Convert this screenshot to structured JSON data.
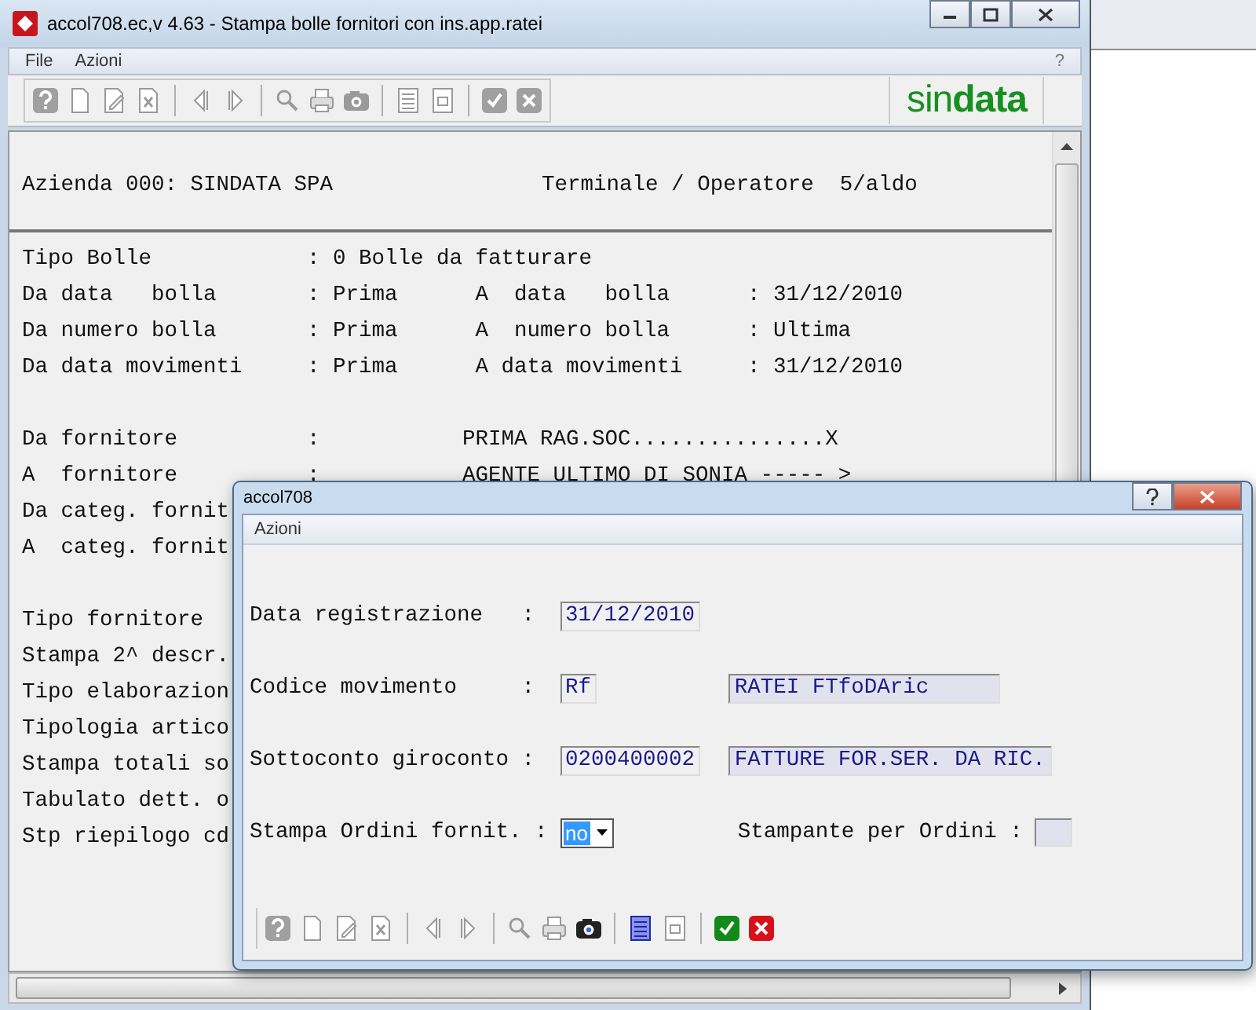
{
  "main_window": {
    "title": "accol708.ec,v 4.63 - Stampa bolle fornitori con ins.app.ratei",
    "menu": [
      "File",
      "Azioni"
    ],
    "help_menu": "?",
    "toolbar": [
      {
        "kind": "help",
        "disabled": true
      },
      {
        "kind": "new",
        "disabled": true
      },
      {
        "kind": "edit",
        "disabled": true
      },
      {
        "kind": "delete",
        "disabled": true
      },
      {
        "kind": "separator"
      },
      {
        "kind": "prev",
        "disabled": true
      },
      {
        "kind": "next",
        "disabled": true
      },
      {
        "kind": "separator"
      },
      {
        "kind": "search",
        "disabled": true
      },
      {
        "kind": "print",
        "disabled": true
      },
      {
        "kind": "camera",
        "disabled": true
      },
      {
        "kind": "separator"
      },
      {
        "kind": "list",
        "disabled": true
      },
      {
        "kind": "preview",
        "disabled": true
      },
      {
        "kind": "separator"
      },
      {
        "kind": "ok",
        "disabled": true
      },
      {
        "kind": "cancel",
        "disabled": true
      }
    ],
    "logo": "sin**data**",
    "header": {
      "company": "Azienda 000: SINDATA SPA",
      "terminal": "Terminale / Operatore  5/aldo"
    },
    "sections": [
      [
        {
          "kind": "single",
          "cells": [
            "Tipo Bolle",
            ": 0 Bolle da fatturare"
          ]
        },
        {
          "kind": "range",
          "cells": [
            "Da data   bolla",
            ": Prima",
            "A  data   bolla",
            ": 31/12/2010"
          ]
        },
        {
          "kind": "range",
          "cells": [
            "Da numero bolla",
            ": Prima",
            "A  numero bolla",
            ": Ultima"
          ]
        },
        {
          "kind": "range",
          "cells": [
            "Da data movimenti",
            ": Prima",
            "A data movimenti",
            ": 31/12/2010"
          ]
        }
      ],
      [
        {
          "kind": "party",
          "cells": [
            "Da fornitore",
            ":",
            "PRIMA RAG.SOC...............X"
          ]
        },
        {
          "kind": "party",
          "cells": [
            "A  fornitore",
            ":",
            "AGENTE ULTIMO DI SONIA ----- >"
          ]
        },
        {
          "kind": "single",
          "cells": [
            "Da categ. fornit"
          ]
        },
        {
          "kind": "single",
          "cells": [
            "A  categ. fornit"
          ]
        }
      ],
      [
        {
          "kind": "single",
          "cells": [
            "Tipo fornitore"
          ]
        },
        {
          "kind": "single",
          "cells": [
            "Stampa 2^ descr."
          ]
        },
        {
          "kind": "single",
          "cells": [
            "Tipo elaborazion"
          ]
        },
        {
          "kind": "single",
          "cells": [
            "Tipologia artico"
          ]
        },
        {
          "kind": "single",
          "cells": [
            "Stampa totali so"
          ]
        },
        {
          "kind": "single",
          "cells": [
            "Tabulato dett. o"
          ]
        },
        {
          "kind": "single",
          "cells": [
            "Stp riepilogo cd"
          ]
        }
      ]
    ]
  },
  "dialog": {
    "title": "accol708",
    "menu": [
      "Azioni"
    ],
    "fields": [
      {
        "kind": "text",
        "label": "Data registrazione   :",
        "value": "31/12/2010"
      },
      {
        "kind": "lookup",
        "label": "Codice movimento     :",
        "value": "Rf",
        "description": "RATEI FTfoDAric"
      },
      {
        "kind": "lookup",
        "label": "Sottoconto giroconto :",
        "value": "0200400002",
        "description": "FATTURE FOR.SER. DA RIC."
      },
      {
        "kind": "select",
        "label": "Stampa Ordini fornit. :",
        "value": "no",
        "extra_label": "Stampante per Ordini :"
      }
    ],
    "toolbar": [
      {
        "kind": "help",
        "disabled": true
      },
      {
        "kind": "new",
        "disabled": true
      },
      {
        "kind": "edit",
        "disabled": true
      },
      {
        "kind": "delete",
        "disabled": true
      },
      {
        "kind": "separator"
      },
      {
        "kind": "prev",
        "disabled": true
      },
      {
        "kind": "next",
        "disabled": true
      },
      {
        "kind": "separator"
      },
      {
        "kind": "search",
        "disabled": true
      },
      {
        "kind": "print",
        "disabled": true
      },
      {
        "kind": "camera",
        "disabled": false
      },
      {
        "kind": "separator"
      },
      {
        "kind": "list",
        "disabled": false
      },
      {
        "kind": "preview",
        "disabled": true
      },
      {
        "kind": "separator"
      },
      {
        "kind": "ok",
        "disabled": false
      },
      {
        "kind": "cancel",
        "disabled": false
      }
    ]
  }
}
